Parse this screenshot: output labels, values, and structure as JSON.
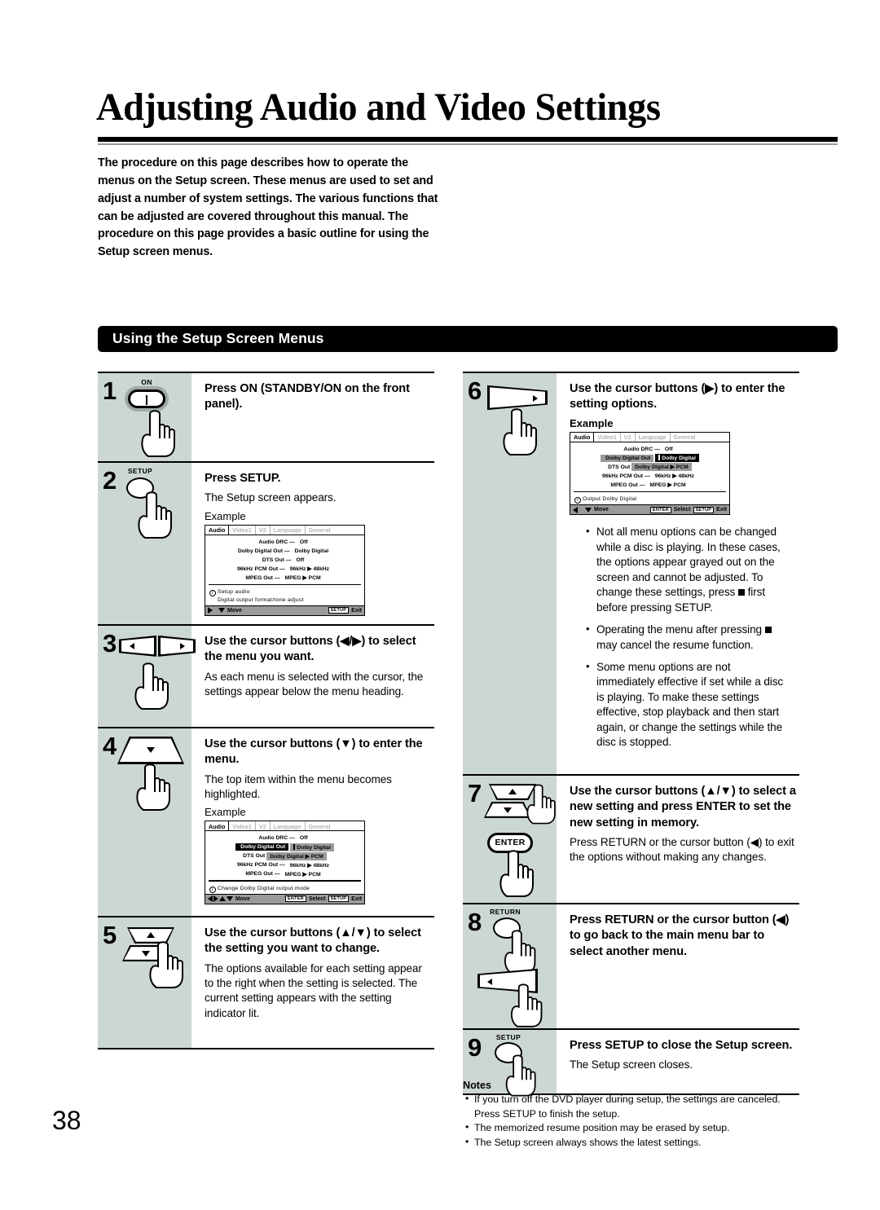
{
  "page": {
    "title": "Adjusting Audio and Video Settings",
    "page_number": "38",
    "intro": "The procedure on this page describes how to operate the menus on the Setup screen. These menus are used to set and adjust a number of system settings. The various functions that can be adjusted are covered throughout this manual. The procedure on this page provides a basic outline for using the Setup screen menus.",
    "section_header": "Using the Setup Screen Menus"
  },
  "steps": {
    "s1": {
      "num": "1",
      "button_label": "ON",
      "title": "Press ON (STANDBY/ON on the front panel).",
      "desc": ""
    },
    "s2": {
      "num": "2",
      "button_label": "SETUP",
      "title": "Press SETUP.",
      "desc": "The Setup screen appears.",
      "example": "Example"
    },
    "s3": {
      "num": "3",
      "title": "Use the cursor buttons (◀/▶) to select the menu you want.",
      "desc": "As each menu is selected with the cursor, the settings appear below the menu heading."
    },
    "s4": {
      "num": "4",
      "title": "Use the cursor buttons (▼) to enter the menu.",
      "desc": "The top item within the menu becomes highlighted.",
      "example": "Example"
    },
    "s5": {
      "num": "5",
      "title": "Use the cursor buttons (▲/▼) to select the setting you want to change.",
      "desc": "The options available for each setting appear to the right when the setting is selected. The current setting appears with the setting indicator lit."
    },
    "s6": {
      "num": "6",
      "title": "Use the cursor buttons (▶)  to enter the setting options.",
      "example": "Example"
    },
    "s7": {
      "num": "7",
      "enter_label": "ENTER",
      "title": "Use the cursor buttons (▲/▼) to select a new  setting and press ENTER to set the new setting in memory.",
      "desc": "Press RETURN or the cursor button (◀) to exit the options without making any changes."
    },
    "s8": {
      "num": "8",
      "button_label": "RETURN",
      "title": "Press RETURN or the cursor button (◀) to go back to the main menu bar to select another menu."
    },
    "s9": {
      "num": "9",
      "button_label": "SETUP",
      "title": "Press SETUP to close the Setup screen.",
      "desc": "The Setup screen closes."
    }
  },
  "osd_tabs": [
    "Audio",
    "Video1",
    "V2",
    "Language",
    "General"
  ],
  "osd_screen_1": {
    "rows": [
      {
        "label": "Audio DRC",
        "value": "Off",
        "dash": true
      },
      {
        "label": "Dolby Digital Out",
        "value": "Dolby Digital",
        "dash": true
      },
      {
        "label": "DTS Out",
        "value": "Off",
        "dash": true
      },
      {
        "label": "96kHz PCM Out",
        "value": "96kHz ▶ 48kHz",
        "dash": true
      },
      {
        "label": "MPEG Out",
        "value": "MPEG ▶ PCM",
        "dash": true
      }
    ],
    "info_line1": "Setup audio",
    "info_line2": "Digital output format/tone adjust",
    "footer": {
      "move": "Move",
      "setup_key": "SETUP",
      "exit": "Exit"
    }
  },
  "osd_screen_2": {
    "rows": [
      {
        "label": "Audio DRC",
        "value": "Off",
        "dash": true
      },
      {
        "label": "Dolby Digital Out",
        "value": "Dolby Digital",
        "dash": false
      },
      {
        "label": "DTS Out",
        "value": "Dolby Digital ▶ PCM",
        "dash": false
      },
      {
        "label": "96kHz PCM Out",
        "value": "96kHz ▶ 48kHz",
        "dash": true
      },
      {
        "label": "MPEG Out",
        "value": "MPEG ▶ PCM",
        "dash": true
      }
    ],
    "info_line1": "Change Dolby Digital output mode",
    "footer": {
      "move": "Move",
      "enter_key": "ENTER",
      "select": "Select",
      "setup_key": "SETUP",
      "exit": "Exit"
    }
  },
  "osd_screen_3": {
    "rows": [
      {
        "label": "Audio DRC",
        "value": "Off",
        "dash": true
      },
      {
        "label": "Dolby Digital Out",
        "value": "Dolby Digital",
        "dash": false
      },
      {
        "label": "DTS Out",
        "value": "Dolby Digital ▶ PCM",
        "dash": false
      },
      {
        "label": "96kHz PCM Out",
        "value": "96kHz ▶ 48kHz",
        "dash": true
      },
      {
        "label": "MPEG Out",
        "value": "MPEG ▶ PCM",
        "dash": true
      }
    ],
    "info_line1": "Output Dolby Digital",
    "footer": {
      "move": "Move",
      "enter_key": "ENTER",
      "select": "Select",
      "setup_key": "SETUP",
      "exit": "Exit"
    }
  },
  "bullets": [
    "Not all menu options can be changed while a disc is playing. In these cases, the options appear grayed out on the screen and cannot be adjusted. To change these settings, press ■ first before pressing SETUP.",
    "Operating the menu after pressing ■ may cancel the resume function.",
    "Some menu options are not immediately effective if set while a disc is playing. To make these settings effective, stop playback and then start again, or change the settings while the disc is stopped."
  ],
  "notes": {
    "heading": "Notes",
    "items": [
      "If you  turn off the DVD player during setup, the settings are canceled. Press SETUP to finish the setup.",
      "The memorized resume position may be erased by setup.",
      "The Setup screen always shows the latest settings."
    ]
  },
  "colors": {
    "step_column_bg": "#ccd7d3",
    "osd_gray": "#9a9a9a",
    "accent_black": "#000000"
  }
}
